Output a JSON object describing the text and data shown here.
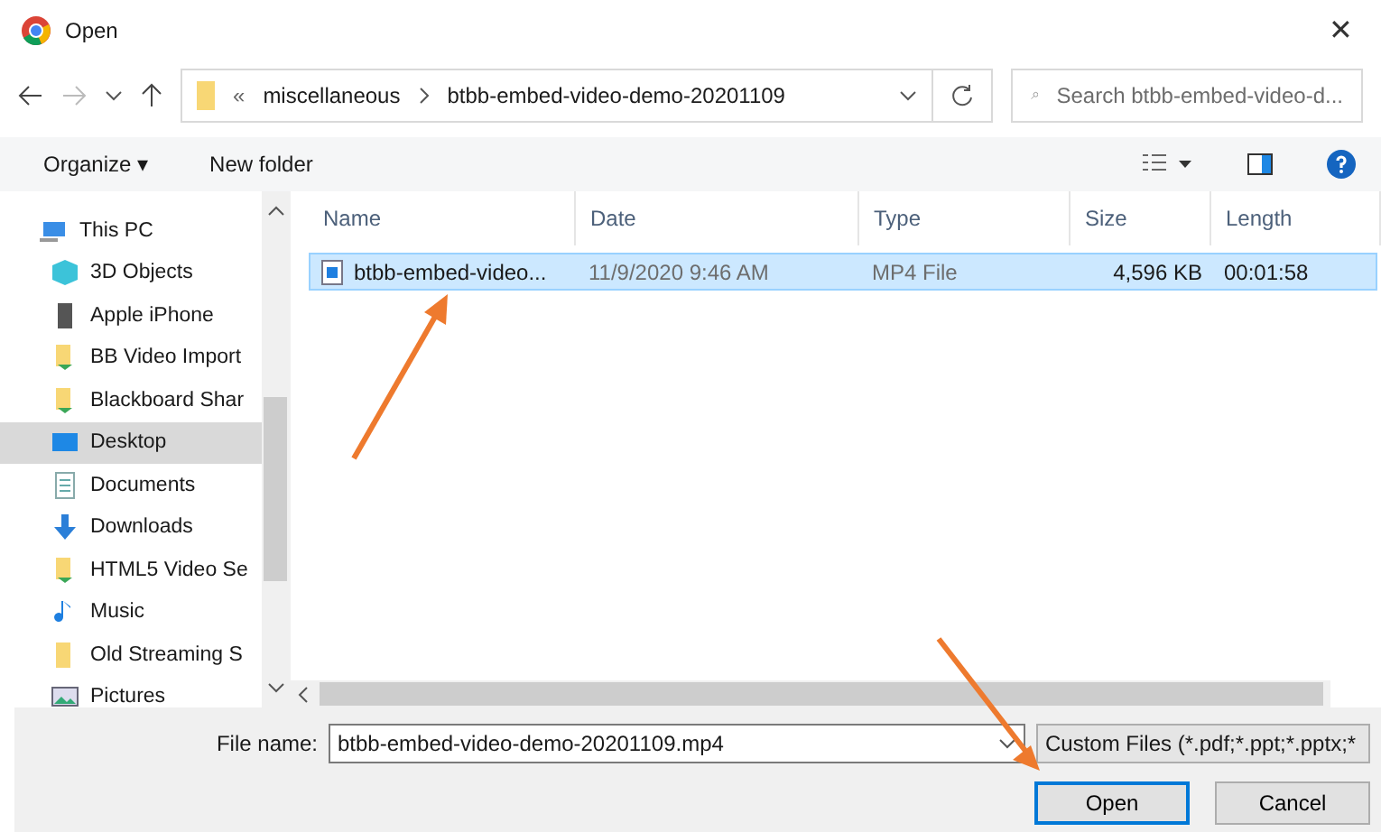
{
  "window": {
    "title": "Open",
    "close": "✕"
  },
  "address": {
    "prefix": "«",
    "path": [
      "miscellaneous",
      "btbb-embed-video-demo-20201109"
    ]
  },
  "search": {
    "placeholder": "Search btbb-embed-video-d..."
  },
  "toolbar": {
    "organize": "Organize ▾",
    "new_folder": "New folder"
  },
  "sidebar": {
    "items": [
      {
        "label": "This PC",
        "kind": "pc",
        "selected": false
      },
      {
        "label": "3D Objects",
        "kind": "cube",
        "selected": false
      },
      {
        "label": "Apple iPhone",
        "kind": "phone",
        "selected": false
      },
      {
        "label": "BB Video Import",
        "kind": "syncfolder",
        "selected": false
      },
      {
        "label": "Blackboard Shar",
        "kind": "syncfolder",
        "selected": false
      },
      {
        "label": "Desktop",
        "kind": "desktop",
        "selected": true
      },
      {
        "label": "Documents",
        "kind": "doc",
        "selected": false
      },
      {
        "label": "Downloads",
        "kind": "download",
        "selected": false
      },
      {
        "label": "HTML5 Video Se",
        "kind": "syncfolder",
        "selected": false
      },
      {
        "label": "Music",
        "kind": "music",
        "selected": false
      },
      {
        "label": "Old Streaming S",
        "kind": "folder",
        "selected": false
      },
      {
        "label": "Pictures",
        "kind": "pictures",
        "selected": false
      }
    ]
  },
  "table": {
    "columns": [
      "Name",
      "Date",
      "Type",
      "Size",
      "Length"
    ],
    "rows": [
      {
        "cells": [
          "btbb-embed-video...",
          "11/9/2020 9:46 AM",
          "MP4 File",
          "4,596 KB",
          "00:01:58"
        ],
        "selected": true
      }
    ]
  },
  "footer": {
    "file_name_label": "File name:",
    "file_name": "btbb-embed-video-demo-20201109.mp4",
    "filter": "Custom Files (*.pdf;*.ppt;*.pptx;*",
    "buttons": [
      "Open",
      "Cancel"
    ]
  }
}
